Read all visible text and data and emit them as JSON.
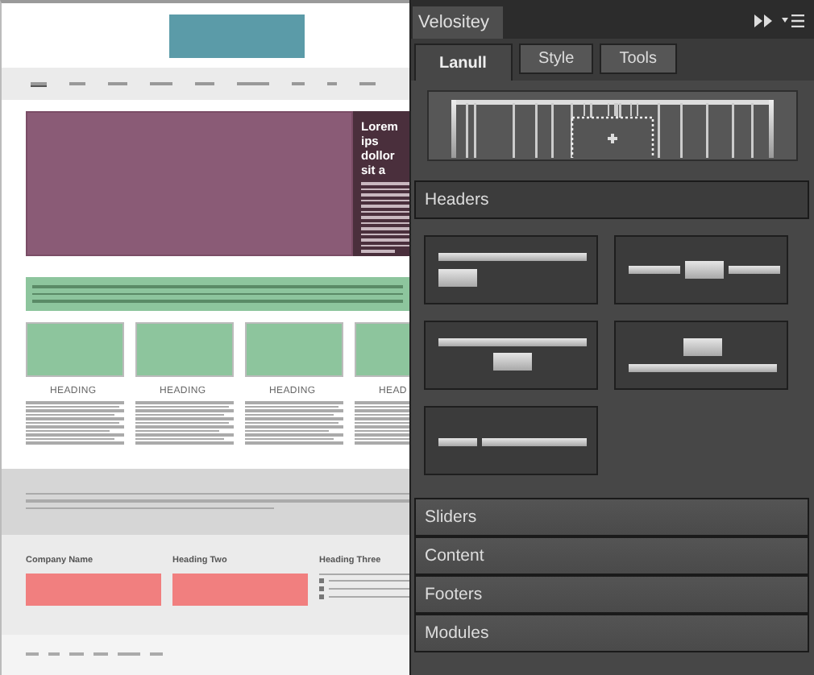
{
  "mockup": {
    "hero": {
      "title": "Lorem ips dollor sit a"
    },
    "nav": [
      {
        "selected": true
      },
      {
        "selected": false
      },
      {
        "selected": false
      },
      {
        "selected": false
      },
      {
        "selected": false
      },
      {
        "selected": false
      },
      {
        "selected": false
      },
      {
        "selected": false
      },
      {
        "selected": false
      }
    ],
    "columns": [
      {
        "heading": "HEADING"
      },
      {
        "heading": "HEADING"
      },
      {
        "heading": "HEADING"
      },
      {
        "heading": "HEAD"
      }
    ],
    "footer_columns": [
      {
        "heading": "Company Name",
        "kind": "box"
      },
      {
        "heading": "Heading Two",
        "kind": "box"
      },
      {
        "heading": "Heading Three",
        "kind": "contact"
      }
    ]
  },
  "panel": {
    "title": "Velositey",
    "tabs": [
      {
        "label": "Lanull",
        "selected": true
      },
      {
        "label": "Style",
        "selected": false
      },
      {
        "label": "Tools",
        "selected": false
      }
    ],
    "sections": [
      {
        "label": "Headers",
        "expanded": true,
        "layouts": [
          {
            "kind": "left"
          },
          {
            "kind": "inline-center"
          },
          {
            "kind": "below-center"
          },
          {
            "kind": "above-center"
          },
          {
            "kind": "inline-left"
          }
        ]
      },
      {
        "label": "Sliders",
        "expanded": false
      },
      {
        "label": "Content",
        "expanded": false
      },
      {
        "label": "Footers",
        "expanded": false
      },
      {
        "label": "Modules",
        "expanded": false
      }
    ]
  }
}
